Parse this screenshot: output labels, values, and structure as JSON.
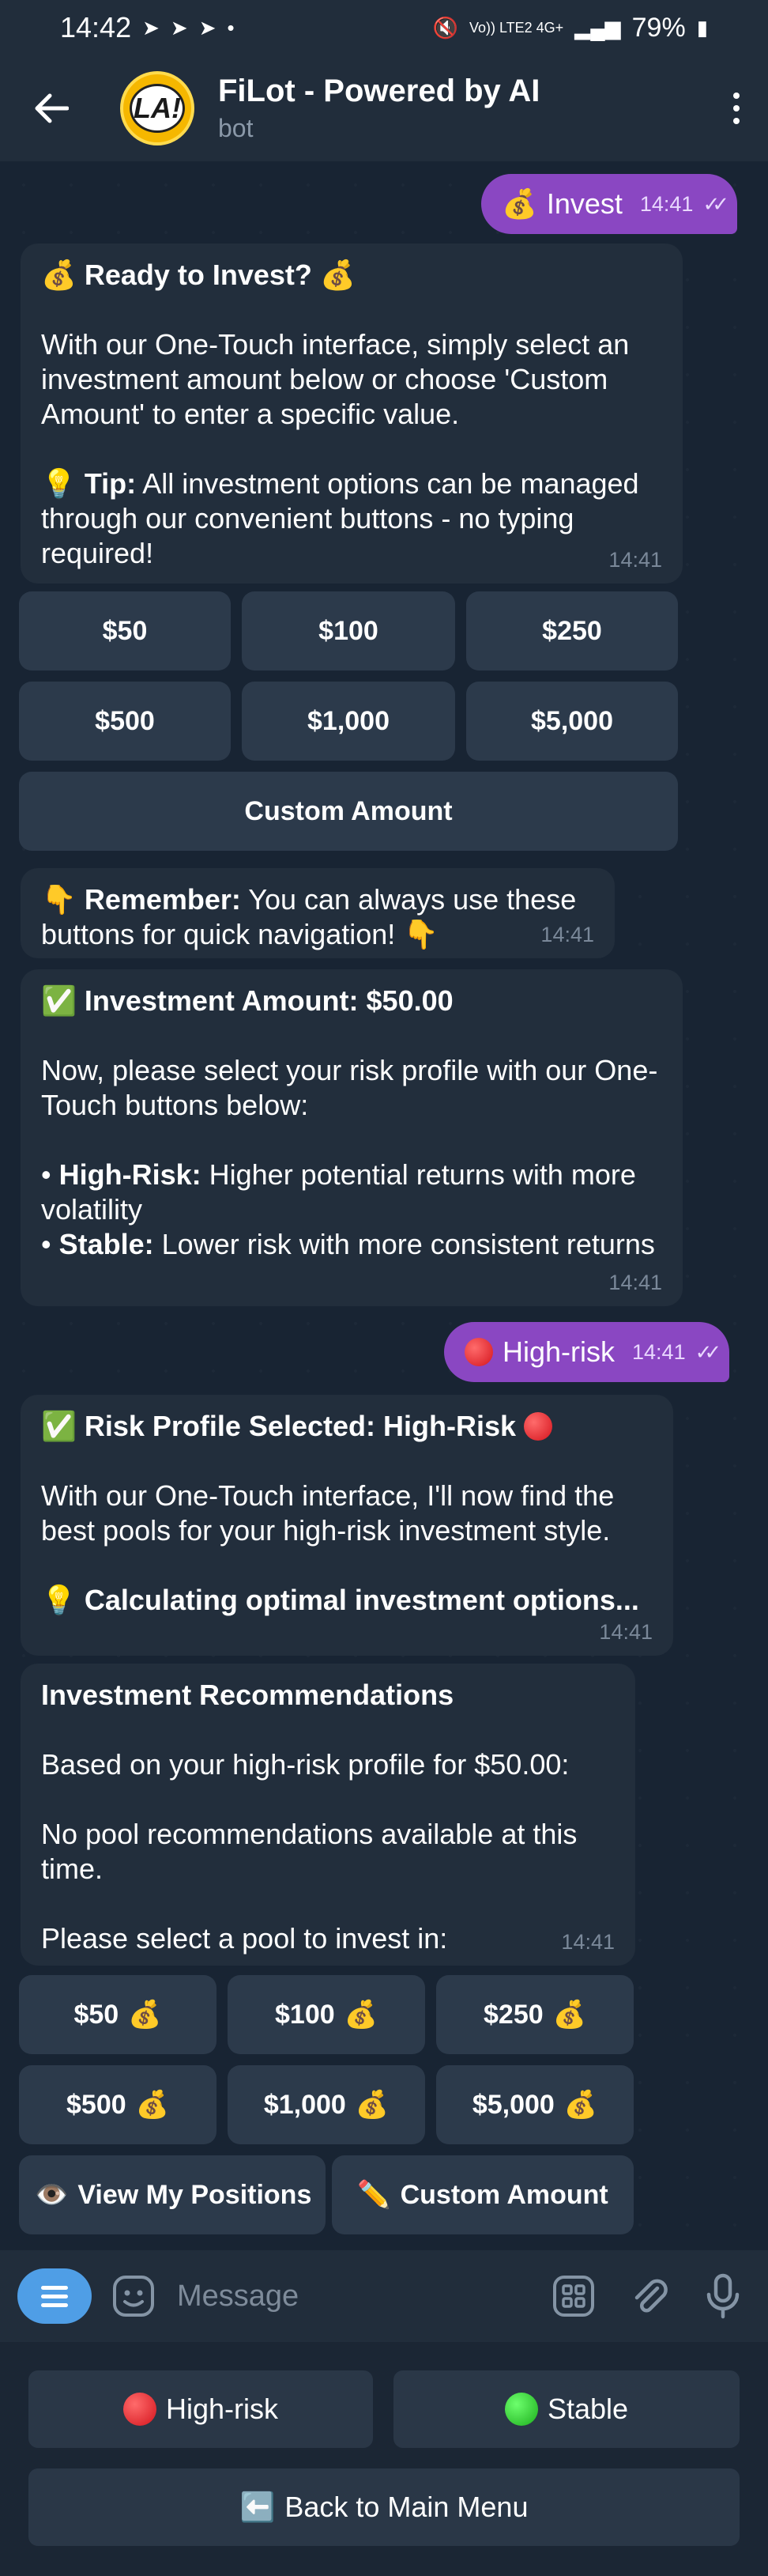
{
  "status_bar": {
    "time": "14:42",
    "network": "Vo)) LTE2 4G+",
    "battery": "79%"
  },
  "header": {
    "title": "FiLot - Powered by AI",
    "subtitle": "bot",
    "avatar_text": "LA!"
  },
  "messages": {
    "invest_out": {
      "text": "Invest",
      "emoji": "💰",
      "time": "14:41"
    },
    "ready": {
      "title": "Ready to Invest?",
      "emoji": "💰",
      "line1": "With our One-Touch interface, simply select an investment amount below or choose 'Custom Amount' to enter a specific value.",
      "tip_label": "Tip:",
      "tip_text": " All investment options can be managed through our convenient buttons - no typing required!",
      "tip_emoji": "💡",
      "time": "14:41"
    },
    "amount_buttons": [
      "$50",
      "$100",
      "$250",
      "$500",
      "$1,000",
      "$5,000"
    ],
    "custom_amount": "Custom Amount",
    "remember": {
      "label": "Remember:",
      "text": " You can always use these buttons for quick navigation!",
      "emoji": "👇",
      "time": "14:41"
    },
    "investment_amount": {
      "title": "Investment Amount: $50.00",
      "emoji": "✅",
      "line1": "Now, please select your risk profile with our One-Touch buttons below:",
      "high_label": "High-Risk:",
      "high_text": " Higher potential returns with more volatility",
      "stable_label": "Stable:",
      "stable_text": " Lower risk with more consistent returns",
      "bullet": "•",
      "time": "14:41"
    },
    "highrisk_out": {
      "text": "High-risk",
      "time": "14:41"
    },
    "risk_selected": {
      "title": "Risk Profile Selected: High-Risk",
      "emoji": "✅",
      "line1": "With our One-Touch interface, I'll now find the best pools for your high-risk investment style.",
      "calc": "Calculating optimal investment options...",
      "calc_emoji": "💡",
      "time": "14:41"
    },
    "recommendations": {
      "title": "Investment Recommendations",
      "line1": "Based on your high-risk profile for $50.00:",
      "line2": "No pool recommendations available at this time.",
      "line3": "Please select a pool to invest in:",
      "time": "14:41"
    },
    "pool_buttons": [
      "$50",
      "$100",
      "$250",
      "$500",
      "$1,000",
      "$5,000"
    ],
    "view_positions": "View My Positions",
    "view_emoji": "👁️",
    "custom_amount2": "Custom Amount",
    "pencil_emoji": "✏️",
    "money_emoji": "💰"
  },
  "input": {
    "placeholder": "Message"
  },
  "reply_keyboard": {
    "high_risk": "High-risk",
    "stable": "Stable",
    "back": "Back to Main Menu",
    "back_emoji": "⬅️"
  }
}
